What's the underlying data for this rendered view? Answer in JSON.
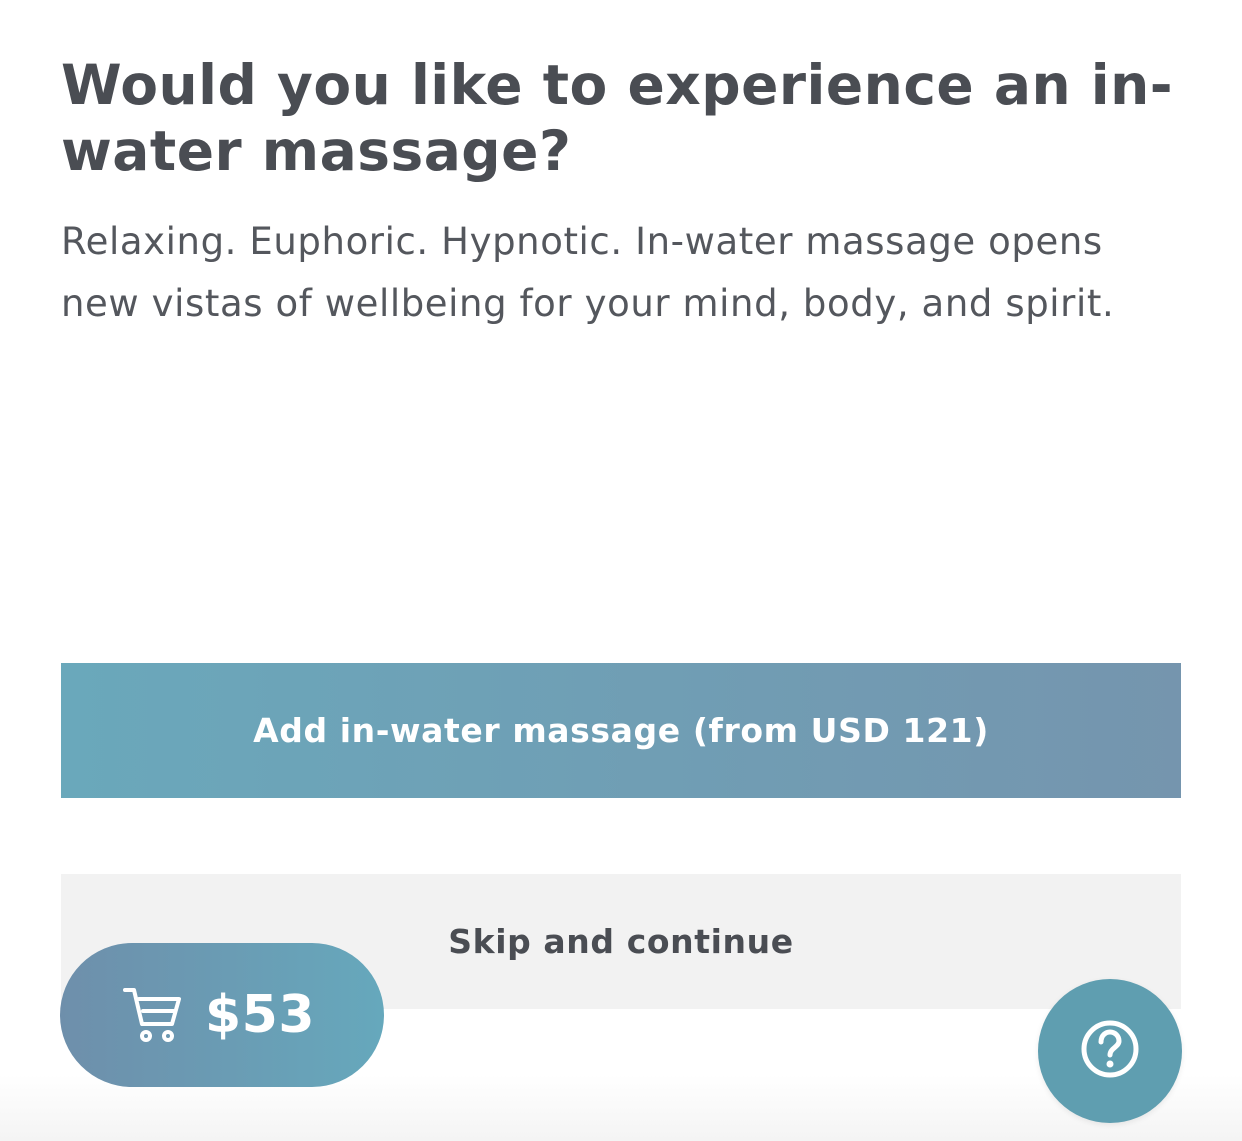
{
  "heading": {
    "title": "Would you like to experience an in-water massage?",
    "description": "Relaxing. Euphoric. Hypnotic. In-water massage opens new vistas of wellbeing for your mind, body, and spirit."
  },
  "actions": {
    "add_label": "Add in-water massage (from USD 121)",
    "skip_label": "Skip and continue"
  },
  "cart": {
    "icon": "shopping-cart-icon",
    "total": "$53"
  },
  "help": {
    "icon": "question-mark-icon"
  },
  "colors": {
    "text_dark": "#4a4d53",
    "accent_teal": "#6aa8bb",
    "accent_slate": "#7595ae",
    "skip_background": "#f2f2f2",
    "help_background": "#5f9eb0"
  }
}
